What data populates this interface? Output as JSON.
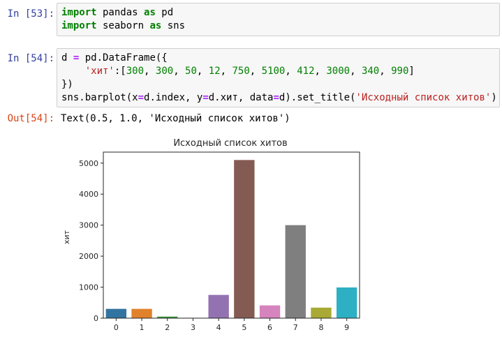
{
  "cells": [
    {
      "prompt": "In [53]:",
      "lines": [
        [
          {
            "t": "import",
            "c": "kw"
          },
          {
            "t": " pandas ",
            "c": ""
          },
          {
            "t": "as",
            "c": "kw"
          },
          {
            "t": " pd",
            "c": ""
          }
        ],
        [
          {
            "t": "import",
            "c": "kw"
          },
          {
            "t": " seaborn ",
            "c": ""
          },
          {
            "t": "as",
            "c": "kw"
          },
          {
            "t": " sns",
            "c": ""
          }
        ]
      ]
    },
    {
      "prompt": "In [54]:",
      "lines": [
        [
          {
            "t": "d ",
            "c": ""
          },
          {
            "t": "=",
            "c": "op"
          },
          {
            "t": " pd.DataFrame({",
            "c": ""
          }
        ],
        [
          {
            "t": "    ",
            "c": ""
          },
          {
            "t": "'хит'",
            "c": "str"
          },
          {
            "t": ":[",
            "c": ""
          },
          {
            "t": "300",
            "c": "num"
          },
          {
            "t": ", ",
            "c": ""
          },
          {
            "t": "300",
            "c": "num"
          },
          {
            "t": ", ",
            "c": ""
          },
          {
            "t": "50",
            "c": "num"
          },
          {
            "t": ", ",
            "c": ""
          },
          {
            "t": "12",
            "c": "num"
          },
          {
            "t": ", ",
            "c": ""
          },
          {
            "t": "750",
            "c": "num"
          },
          {
            "t": ", ",
            "c": ""
          },
          {
            "t": "5100",
            "c": "num"
          },
          {
            "t": ", ",
            "c": ""
          },
          {
            "t": "412",
            "c": "num"
          },
          {
            "t": ", ",
            "c": ""
          },
          {
            "t": "3000",
            "c": "num"
          },
          {
            "t": ", ",
            "c": ""
          },
          {
            "t": "340",
            "c": "num"
          },
          {
            "t": ", ",
            "c": ""
          },
          {
            "t": "990",
            "c": "num"
          },
          {
            "t": "]",
            "c": ""
          }
        ],
        [
          {
            "t": "})",
            "c": ""
          }
        ],
        [
          {
            "t": "sns.barplot(x",
            "c": ""
          },
          {
            "t": "=",
            "c": "op"
          },
          {
            "t": "d.index, y",
            "c": ""
          },
          {
            "t": "=",
            "c": "op"
          },
          {
            "t": "d.хит, data",
            "c": ""
          },
          {
            "t": "=",
            "c": "op"
          },
          {
            "t": "d).set_title(",
            "c": ""
          },
          {
            "t": "'Исходный список хитов'",
            "c": "str"
          },
          {
            "t": ")",
            "c": ""
          }
        ]
      ]
    }
  ],
  "output": {
    "prompt": "Out[54]:",
    "text": "Text(0.5, 1.0, 'Исходный список хитов')"
  },
  "chart_data": {
    "type": "bar",
    "title": "Исходный список хитов",
    "xlabel": "",
    "ylabel": "хит",
    "categories": [
      "0",
      "1",
      "2",
      "3",
      "4",
      "5",
      "6",
      "7",
      "8",
      "9"
    ],
    "values": [
      300,
      300,
      50,
      12,
      750,
      5100,
      412,
      3000,
      340,
      990
    ],
    "ylim": [
      0,
      5355
    ],
    "yticks": [
      0,
      1000,
      2000,
      3000,
      4000,
      5000
    ],
    "colors": [
      "#3274a1",
      "#e1812c",
      "#3a923a",
      "#c03d3e",
      "#9372b2",
      "#845b53",
      "#d684bd",
      "#7f7f7f",
      "#a9aa35",
      "#2eb0c4"
    ],
    "grid": false,
    "legend": "none"
  }
}
